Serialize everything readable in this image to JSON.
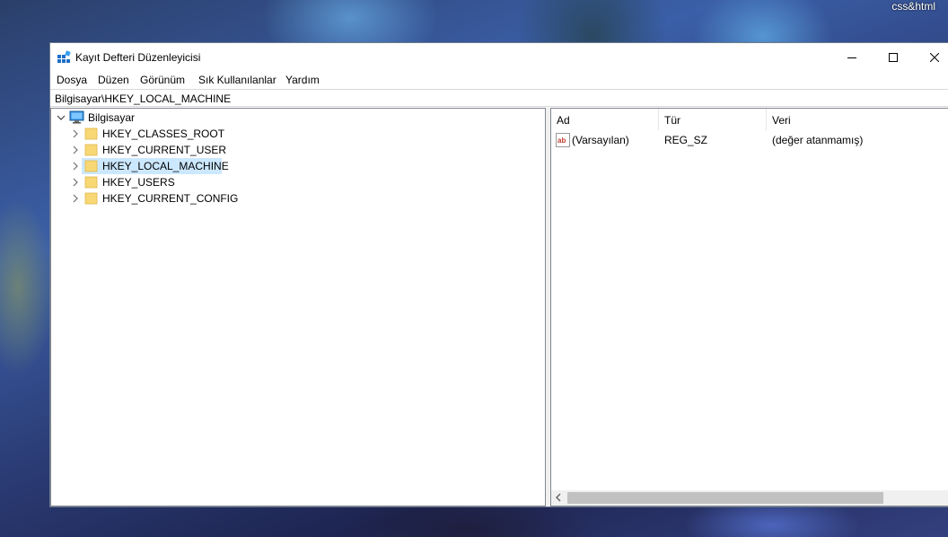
{
  "desktop": {
    "corner_label": "css&html"
  },
  "window": {
    "title": "Kayıt Defteri Düzenleyicisi",
    "controls": {
      "minimize": "minimize-icon",
      "maximize": "maximize-icon",
      "close": "close-icon"
    }
  },
  "menu": {
    "items": [
      {
        "label": "Dosya"
      },
      {
        "label": "Düzen"
      },
      {
        "label": "Görünüm"
      },
      {
        "label": "Sık Kullanılanlar"
      },
      {
        "label": "Yardım"
      }
    ]
  },
  "address": {
    "path": "Bilgisayar\\HKEY_LOCAL_MACHINE"
  },
  "tree": {
    "root": {
      "label": "Bilgisayar",
      "icon": "computer-icon",
      "expanded": true
    },
    "children": [
      {
        "label": "HKEY_CLASSES_ROOT",
        "icon": "folder-icon",
        "selected": false
      },
      {
        "label": "HKEY_CURRENT_USER",
        "icon": "folder-icon",
        "selected": false
      },
      {
        "label": "HKEY_LOCAL_MACHINE",
        "icon": "folder-icon",
        "selected": true
      },
      {
        "label": "HKEY_USERS",
        "icon": "folder-icon",
        "selected": false
      },
      {
        "label": "HKEY_CURRENT_CONFIG",
        "icon": "folder-icon",
        "selected": false
      }
    ]
  },
  "values_list": {
    "columns": [
      {
        "label": "Ad"
      },
      {
        "label": "Tür"
      },
      {
        "label": "Veri"
      }
    ],
    "rows": [
      {
        "name": "(Varsayılan)",
        "type": "REG_SZ",
        "data": "(değer atanmamış)",
        "icon": "string-value-icon"
      }
    ]
  },
  "colors": {
    "selection": "#cce8ff",
    "folder": "#f8d775",
    "window_border": "#6b7a8c"
  }
}
